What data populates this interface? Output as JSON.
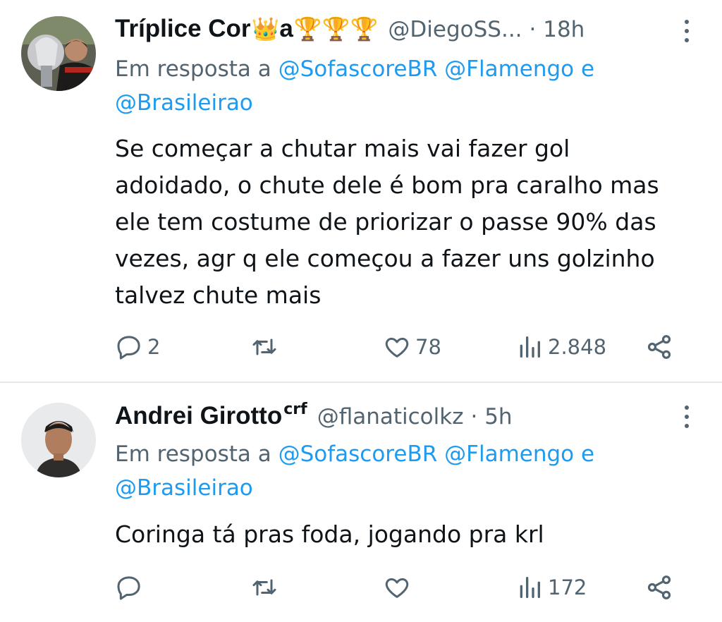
{
  "tweets": [
    {
      "display_name": "Tríplice Cor",
      "display_name_suffix": "a",
      "name_emojis": {
        "crown": "👑",
        "trophies": "🏆🏆🏆"
      },
      "badge": "",
      "handle": "@DiegoSS...",
      "time": "· 18h",
      "reply_prefix": "Em resposta a",
      "reply_mentions": [
        "@SofascoreBR",
        "@Flamengo"
      ],
      "reply_and": "e",
      "reply_last_mention": "@Brasileirao",
      "text_lines": [
        "Se começar a chutar mais vai fazer gol",
        "adoidado, o chute dele é bom pra caralho mas",
        "ele tem costume de priorizar o passe 90% das",
        "vezes, agr q ele começou a fazer uns golzinho",
        "talvez chute mais"
      ],
      "replies": "2",
      "retweets": "",
      "likes": "78",
      "views": "2.848"
    },
    {
      "display_name": "Andrei Girotto",
      "badge": "crf",
      "handle": "@flanaticolkz",
      "time": "· 5h",
      "reply_prefix": "Em resposta a",
      "reply_mentions": [
        "@SofascoreBR",
        "@Flamengo"
      ],
      "reply_and": "e",
      "reply_last_mention": "@Brasileirao",
      "text_lines": [
        "Coringa tá pras foda, jogando pra krl"
      ],
      "replies": "",
      "retweets": "",
      "likes": "",
      "views": "172"
    }
  ],
  "icons": {
    "reply": "reply-icon",
    "retweet": "retweet-icon",
    "like": "heart-icon",
    "views": "views-icon",
    "share": "share-icon",
    "more": "more-vertical-icon"
  },
  "colors": {
    "mention": "#1d9bf0",
    "secondary_text": "#536471",
    "primary_text": "#0f1419",
    "divider": "#e6e9ec"
  }
}
